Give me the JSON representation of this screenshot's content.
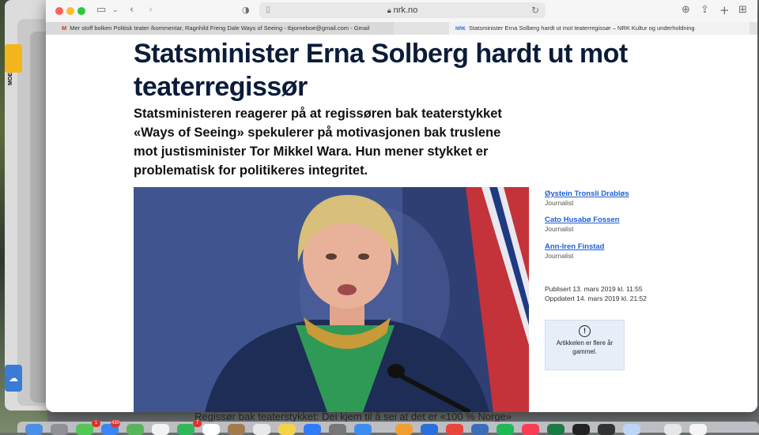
{
  "browser": {
    "url": "nrk.no",
    "tabs": [
      {
        "icon": "gmail-icon",
        "icon_glyph": "M",
        "title": "Mer stoff bolken Politisk teater /kommentar, Ragnhild Freng Dale Ways of Seeing - tbjornebo​e@gmail.com - Gmail"
      },
      {
        "icon": "nrk-icon",
        "icon_glyph": "NRK",
        "title": "Statsminister Erna Solberg hardt ut mot teaterregissør – NRK Kultur og underholdning"
      }
    ]
  },
  "article": {
    "headline": "Statsminister Erna Solberg hardt ut mot teaterregissør",
    "lead": "Statsministeren reagerer på at regissøren bak teaterstykket «Ways of Seeing» spekulerer på motivasjonen bak truslene mot justisminister Tor Mikkel Wara. Hun mener stykket er problematisk for politikeres integritet.",
    "authors": [
      {
        "name": "Øystein Tronsli Drabløs",
        "role": "Journalist"
      },
      {
        "name": "Cato Husabø Fossen",
        "role": "Journalist"
      },
      {
        "name": "Ann-Iren Finstad",
        "role": "Journalist"
      }
    ],
    "published": "Publisert 13. mars 2019 kl. 11:55",
    "updated": "Oppdatert 14. mars 2019 kl. 21:52",
    "notice": "Artikkelen er flere år gammel."
  },
  "desktop": {
    "side_label": "MOE",
    "behind_text": "Regissør bak teaterstykket: Dei kjem til å sei at det er «100 % Norge»",
    "dock_badges": [
      "1",
      "430",
      "7"
    ]
  },
  "colors": {
    "headline": "#0b1c3a",
    "link": "#1f5fd6",
    "notice_bg": "#e7eef8"
  }
}
